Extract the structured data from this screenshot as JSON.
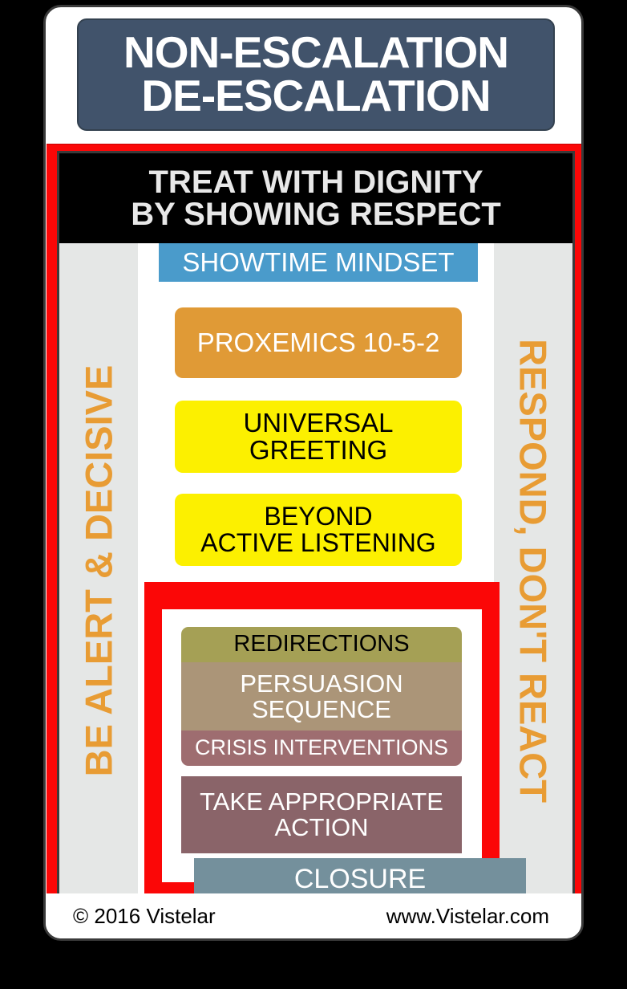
{
  "title": {
    "line1": "NON-ESCALATION",
    "line2": "DE-ESCALATION",
    "bg_color": "#41536b"
  },
  "banner": {
    "line1": "TREAT WITH DIGNITY",
    "line2": "BY SHOWING RESPECT",
    "bg_color": "#000000",
    "text_color": "#e8e8e8"
  },
  "rails": {
    "left_label": "BE ALERT & DECISIVE",
    "right_label": "RESPOND, DON'T REACT",
    "bg_color": "#e5e7e6",
    "text_color": "#e89c34"
  },
  "frame": {
    "outer_red": "#fb0707",
    "inner_red": "#fb0707"
  },
  "steps": [
    {
      "id": "showtime",
      "label": "SHOWTIME MINDSET",
      "bg": "#4a9bcb",
      "fg": "#ffffff"
    },
    {
      "id": "proxemics",
      "label": "PROXEMICS 10-5-2",
      "bg": "#e09a36",
      "fg": "#ffffff"
    },
    {
      "id": "greeting",
      "label": "UNIVERSAL GREETING",
      "bg": "#fcf000",
      "fg": "#000000"
    },
    {
      "id": "listening",
      "line1": "BEYOND",
      "line2": "ACTIVE LISTENING",
      "bg": "#fcf000",
      "fg": "#000000"
    },
    {
      "id": "redirections",
      "label": "REDIRECTIONS",
      "bg": "#a5a055",
      "fg": "#000000"
    },
    {
      "id": "persuasion",
      "line1": "PERSUASION",
      "line2": "SEQUENCE",
      "bg": "#ab9578",
      "fg": "#ffffff"
    },
    {
      "id": "crisis",
      "label": "CRISIS INTERVENTIONS",
      "bg": "#9e6d70",
      "fg": "#ffffff"
    },
    {
      "id": "action",
      "line1": "TAKE APPROPRIATE",
      "line2": "ACTION",
      "bg": "#8a6469",
      "fg": "#ffffff"
    },
    {
      "id": "closure",
      "label": "CLOSURE",
      "bg": "#74909c",
      "fg": "#ffffff"
    }
  ],
  "footer": {
    "copyright": "© 2016 Vistelar",
    "website": "www.Vistelar.com"
  }
}
